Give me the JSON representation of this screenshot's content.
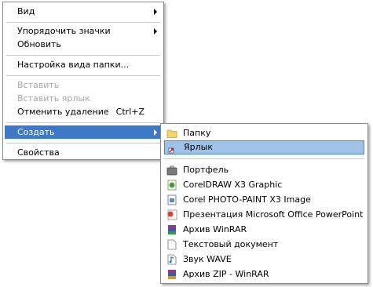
{
  "context_menu": {
    "view": "Вид",
    "arrange_icons": "Упорядочить значки",
    "refresh": "Обновить",
    "folder_view_settings": "Настройка вида папки...",
    "paste": "Вставить",
    "paste_shortcut": "Вставить ярлык",
    "undo_delete": "Отменить удаление",
    "undo_delete_shortcut": "Ctrl+Z",
    "create": "Создать",
    "properties": "Свойства"
  },
  "create_submenu": {
    "items": [
      {
        "label": "Папку",
        "icon": "folder-icon"
      },
      {
        "label": "Ярлык",
        "icon": "shortcut-icon"
      },
      {
        "label": "Портфель",
        "icon": "briefcase-icon"
      },
      {
        "label": "CorelDRAW X3 Graphic",
        "icon": "coreldraw-icon"
      },
      {
        "label": "Corel PHOTO-PAINT X3 Image",
        "icon": "photopaint-icon"
      },
      {
        "label": "Презентация Microsoft Office PowerPoint",
        "icon": "powerpoint-icon"
      },
      {
        "label": "Архив WinRAR",
        "icon": "winrar-icon"
      },
      {
        "label": "Текстовый документ",
        "icon": "text-document-icon"
      },
      {
        "label": "Звук WAVE",
        "icon": "wave-sound-icon"
      },
      {
        "label": "Архив ZIP - WinRAR",
        "icon": "zip-archive-icon"
      }
    ]
  },
  "colors": {
    "highlight": "#3d79c6",
    "submenu_highlight": "#9fc2e9",
    "disabled_text": "#a7a7a7"
  }
}
